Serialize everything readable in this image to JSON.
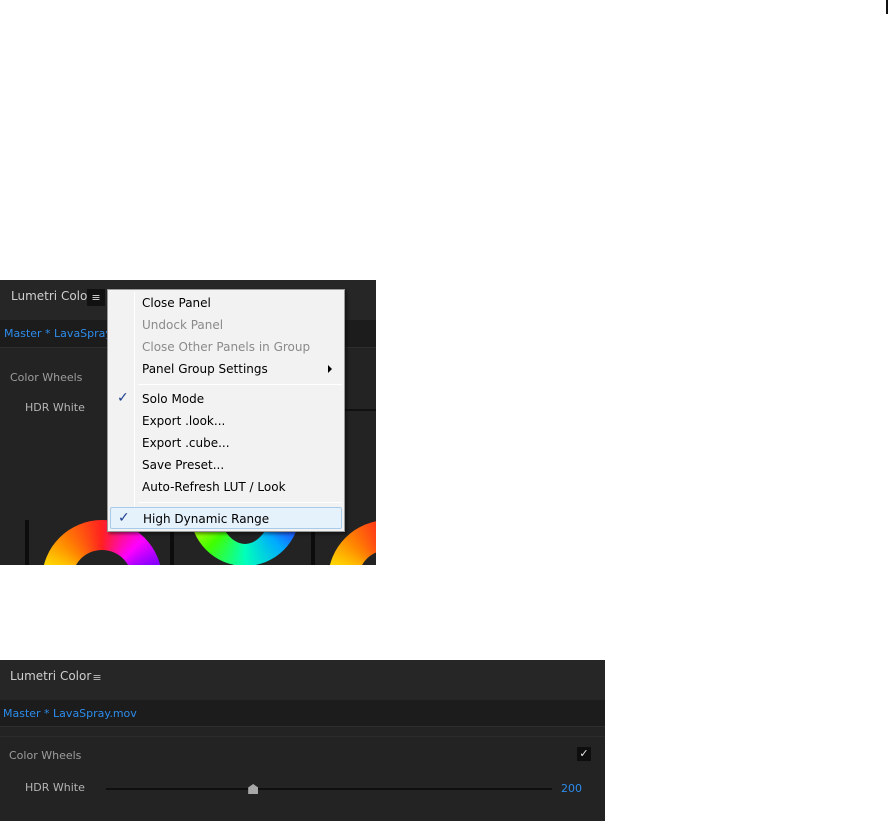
{
  "top_panel": {
    "title": "Lumetri Color",
    "menu_icon": "hamburger-icon",
    "menu_glyph": "≡",
    "clip_label": "Master * LavaSpray.mov",
    "section_label": "Color Wheels",
    "hdr_label": "HDR White"
  },
  "context_menu": {
    "items": [
      {
        "label": "Close Panel",
        "enabled": true,
        "checked": false,
        "submenu": false
      },
      {
        "label": "Undock Panel",
        "enabled": false,
        "checked": false,
        "submenu": false
      },
      {
        "label": "Close Other Panels in Group",
        "enabled": false,
        "checked": false,
        "submenu": false
      },
      {
        "label": "Panel Group Settings",
        "enabled": true,
        "checked": false,
        "submenu": true
      },
      {
        "label": "Solo Mode",
        "enabled": true,
        "checked": true,
        "submenu": false
      },
      {
        "label": "Export .look...",
        "enabled": true,
        "checked": false,
        "submenu": false
      },
      {
        "label": "Export .cube...",
        "enabled": true,
        "checked": false,
        "submenu": false
      },
      {
        "label": "Save Preset...",
        "enabled": true,
        "checked": false,
        "submenu": false
      },
      {
        "label": "Auto-Refresh LUT / Look",
        "enabled": true,
        "checked": false,
        "submenu": false
      },
      {
        "label": "High Dynamic Range",
        "enabled": true,
        "checked": true,
        "submenu": false,
        "highlighted": true
      }
    ],
    "check_glyph": "✓"
  },
  "bottom_panel": {
    "title": "Lumetri Color",
    "menu_glyph": "≡",
    "clip_label": "Master * LavaSpray.mov",
    "section_label": "Color Wheels",
    "section_checked": true,
    "check_glyph": "✓",
    "hdr_label": "HDR White",
    "hdr_value": "200",
    "hdr_slider_fraction": 0.33
  },
  "colors": {
    "panel_bg": "#232323",
    "accent_blue": "#2d8ceb",
    "menu_bg": "#f2f2f2",
    "menu_highlight": "#e5f1fb"
  }
}
